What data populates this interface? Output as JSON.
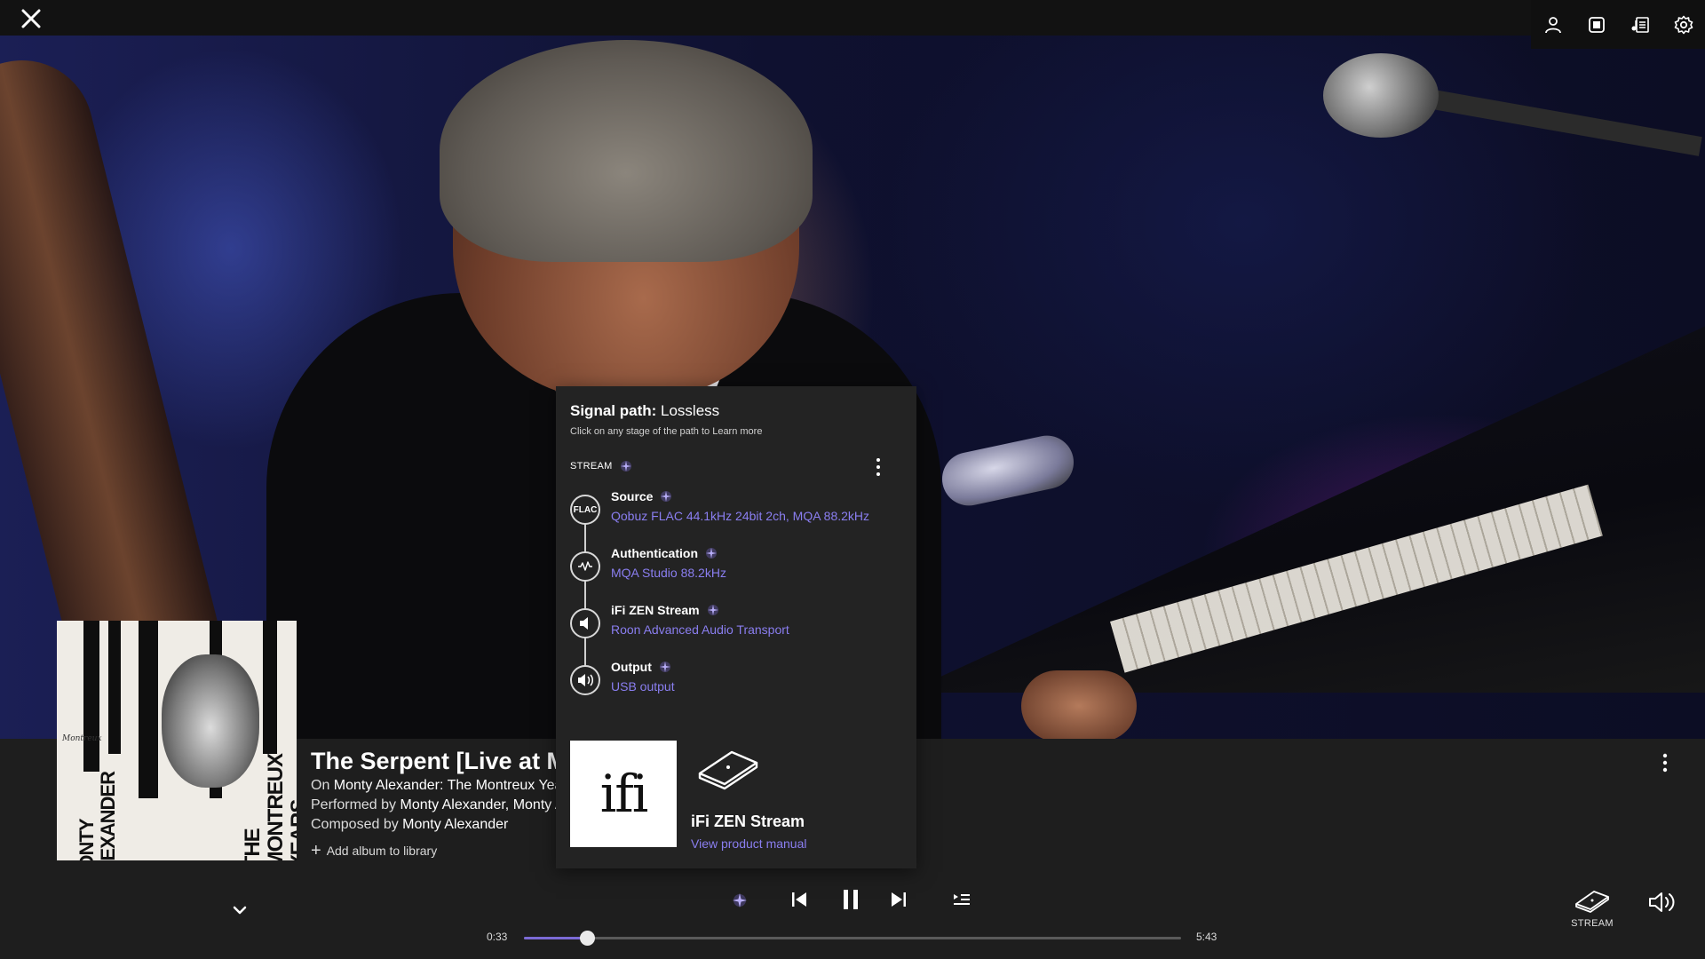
{
  "topbar": {
    "icons": [
      "user-icon",
      "screen-icon",
      "lyrics-icon",
      "gear-icon"
    ]
  },
  "track": {
    "title": "The Serpent [Live at Montreux]",
    "on_prefix": "On",
    "album": "Monty Alexander: The Montreux Years",
    "performed_prefix": "Performed by",
    "performers": "Monty Alexander, Monty Alexander Trio",
    "composed_prefix": "Composed by",
    "composer": "Monty Alexander",
    "add_album": "Add album to library"
  },
  "album_art": {
    "artist": "MONTY ALEXANDER",
    "title": "THE MONTREUX YEARS",
    "logo": "Montreux"
  },
  "signal_path": {
    "title": "Signal path:",
    "quality": "Lossless",
    "subtitle": "Click on any stage of the path to Learn more",
    "zone": "STREAM",
    "stages": [
      {
        "name": "Source",
        "icon_label": "FLAC",
        "detail": "Qobuz FLAC 44.1kHz 24bit 2ch, MQA 88.2kHz"
      },
      {
        "name": "Authentication",
        "icon_label": "",
        "detail": "MQA Studio 88.2kHz"
      },
      {
        "name": "iFi ZEN Stream",
        "icon_label": "",
        "detail": "Roon Advanced Audio Transport"
      },
      {
        "name": "Output",
        "icon_label": "",
        "detail": "USB output"
      }
    ],
    "device": {
      "logo": "ifi",
      "name": "iFi ZEN Stream",
      "link": "View product manual"
    }
  },
  "player": {
    "elapsed": "0:33",
    "duration": "5:43",
    "progress": 0.096,
    "zone_label": "STREAM"
  },
  "colors": {
    "accent": "#7b6ad6",
    "link": "#8a7ef0",
    "popup_bg": "#232323",
    "player_bg": "#1e1e1e"
  }
}
